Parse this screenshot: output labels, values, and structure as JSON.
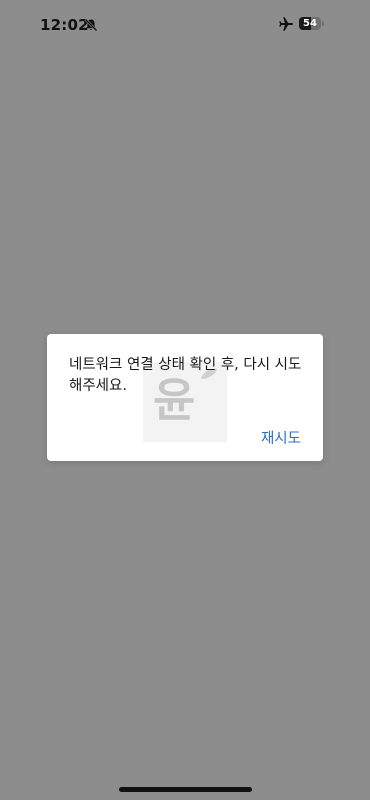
{
  "status_bar": {
    "time": "12:02",
    "battery_level": "54",
    "icons": [
      "bell-slash-icon",
      "airplane-icon",
      "battery-icon"
    ]
  },
  "dialog": {
    "message": "네트워크 연결 상태 확인 후, 다시 시도해주세요.",
    "retry_label": "재시도",
    "watermark_char": "윤"
  },
  "colors": {
    "overlay": "#8d8d8d",
    "dialog_bg": "#ffffff",
    "accent": "#2b6fc4",
    "text": "#1a1a1a"
  }
}
